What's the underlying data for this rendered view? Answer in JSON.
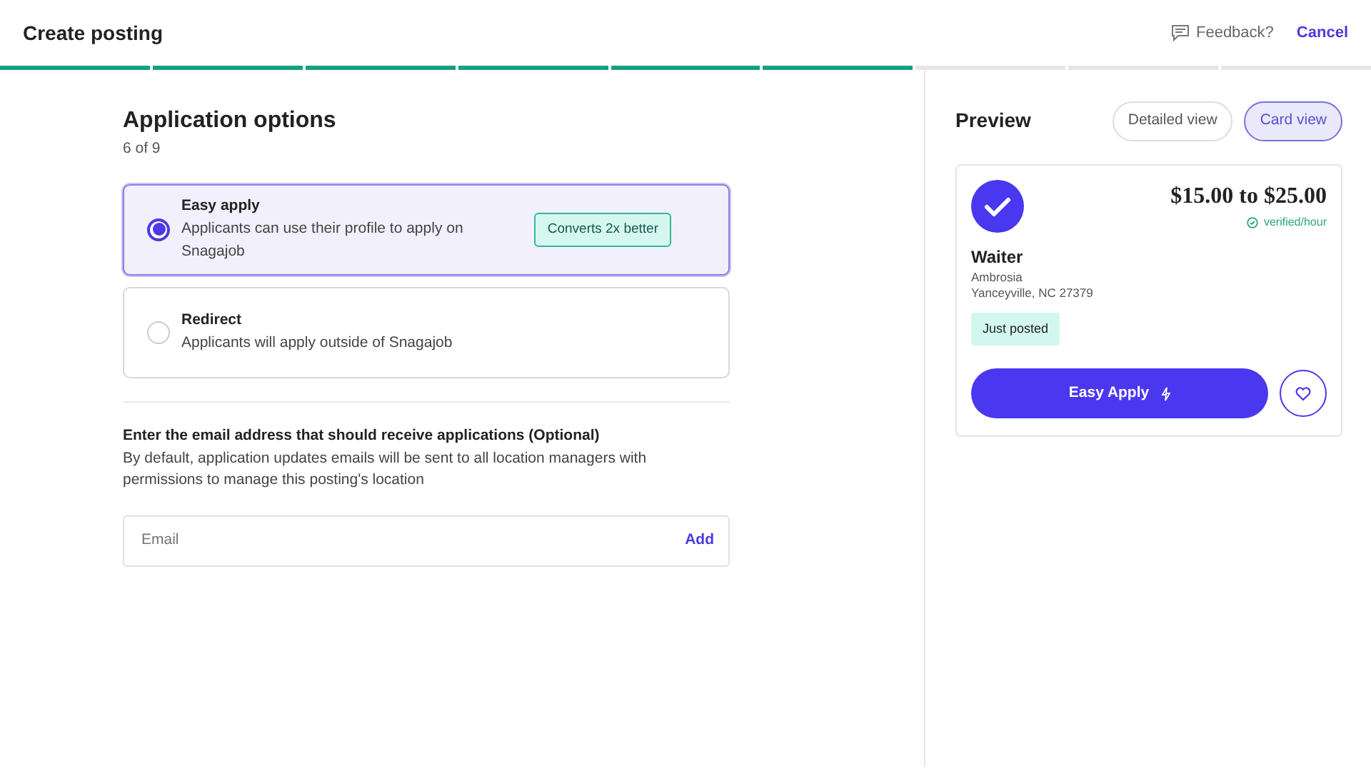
{
  "header": {
    "title": "Create posting",
    "feedback": "Feedback?",
    "cancel": "Cancel"
  },
  "progress": [
    {
      "done": true
    },
    {
      "done": true
    },
    {
      "done": true
    },
    {
      "done": true
    },
    {
      "done": true
    },
    {
      "done": true
    },
    {
      "done": false
    },
    {
      "done": false
    },
    {
      "done": false
    }
  ],
  "section": {
    "title": "Application options",
    "step": "6 of 9"
  },
  "options": [
    {
      "title": "Easy apply",
      "description": "Applicants can use their profile to apply on Snagajob",
      "badge": "Converts 2x better",
      "selected": true
    },
    {
      "title": "Redirect",
      "description": "Applicants will apply outside of Snagajob",
      "selected": false
    }
  ],
  "email": {
    "heading": "Enter the email address that should receive applications (Optional)",
    "description": "By default, application updates emails will be sent to all location managers with permissions to manage this posting's location",
    "placeholder": "Email",
    "action": "Add"
  },
  "preview": {
    "title": "Preview",
    "views": [
      {
        "label": "Detailed view",
        "selected": false
      },
      {
        "label": "Card view",
        "selected": true
      }
    ],
    "card": {
      "pay": "$15.00 to $25.00",
      "pay_note": "verified/hour",
      "job": "Waiter",
      "company": "Ambrosia",
      "location": "Yanceyville, NC 27379",
      "tag": "Just posted",
      "apply": "Easy Apply"
    }
  }
}
